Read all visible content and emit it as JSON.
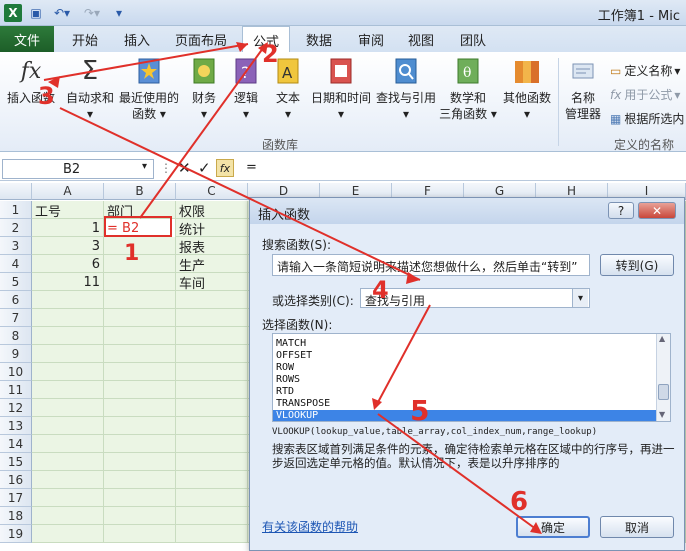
{
  "app": {
    "title": "工作簿1 - Mic"
  },
  "tabs": [
    "文件",
    "开始",
    "插入",
    "页面布局",
    "公式",
    "数据",
    "审阅",
    "视图",
    "团队"
  ],
  "ribbon": {
    "insert_function": "插入函数",
    "autosum": "自动求和",
    "recent": [
      "最近使用的",
      "函数"
    ],
    "financial": "财务",
    "logical": "逻辑",
    "text": "文本",
    "datetime": "日期和时间",
    "lookup": "查找与引用",
    "math": [
      "数学和",
      "三角函数"
    ],
    "more": "其他函数",
    "library_label": "函数库",
    "name_manager": [
      "名称",
      "管理器"
    ],
    "define_name": "定义名称",
    "use_in_formula": "用于公式",
    "create_from_selection": "根据所选内",
    "defined_names_label": "定义的名称"
  },
  "formula_bar": {
    "cell": "B2",
    "content": "="
  },
  "sheet": {
    "columns": [
      "A",
      "B",
      "C",
      "D",
      "E",
      "F",
      "G",
      "H",
      "I"
    ],
    "rows": [
      "1",
      "2",
      "3",
      "4",
      "5",
      "6",
      "7",
      "8",
      "9",
      "10",
      "11",
      "12",
      "13",
      "14",
      "15",
      "16",
      "17",
      "18",
      "19"
    ],
    "a": [
      "工号",
      "1",
      "3",
      "6",
      "11"
    ],
    "b": [
      "部门",
      "= B2"
    ],
    "c": [
      "权限",
      "统计",
      "报表",
      "生产",
      "车间"
    ]
  },
  "dialog": {
    "title": "插入函数",
    "help_btn": "?",
    "close_btn": "✕",
    "search_label": "搜索函数(S):",
    "search_text": "请输入一条简短说明来描述您想做什么，然后单击“转到”",
    "go_btn": "转到(G)",
    "category_label": "或选择类别(C):",
    "category_value": "查找与引用",
    "select_label": "选择函数(N):",
    "functions": [
      "MATCH",
      "OFFSET",
      "ROW",
      "ROWS",
      "RTD",
      "TRANSPOSE",
      "VLOOKUP"
    ],
    "signature": "VLOOKUP(lookup_value,table_array,col_index_num,range_lookup)",
    "description": "搜索表区域首列满足条件的元素，确定待检索单元格在区域中的行序号，再进一步返回选定单元格的值。默认情况下，表是以升序排序的",
    "help_link": "有关该函数的帮助",
    "ok": "确定",
    "cancel": "取消"
  },
  "annotations": [
    "1",
    "2",
    "3",
    "4",
    "5",
    "6"
  ],
  "colors": {
    "annotation": "#e0302a",
    "file_tab": "#217346",
    "sheet_fill": "#ebf5e4",
    "selection": "#3d84e6"
  }
}
